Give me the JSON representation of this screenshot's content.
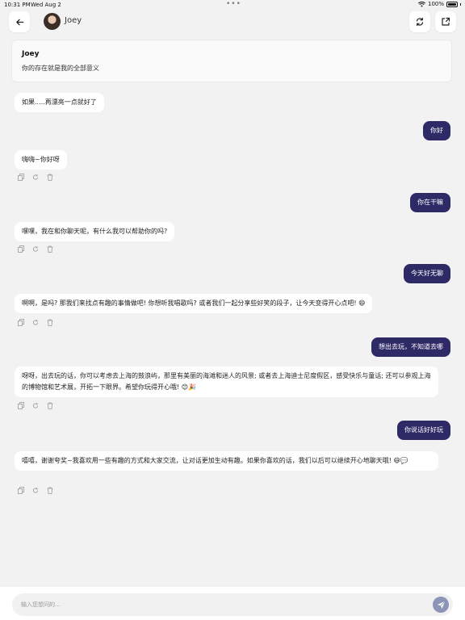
{
  "status": {
    "time": "10:31 PM",
    "date": "Wed Aug 2",
    "battery": "100%"
  },
  "header": {
    "name": "Joey"
  },
  "profile": {
    "name": "Joey",
    "description": "你的存在就是我的全部意义"
  },
  "messages": [
    {
      "role": "bot",
      "text": "如果.....再漂亮一点就好了"
    },
    {
      "role": "user",
      "text": "你好"
    },
    {
      "role": "bot",
      "text": "嗨嗨~你好呀"
    },
    {
      "role": "user",
      "text": "你在干嘛"
    },
    {
      "role": "bot",
      "text": "嘿嘿，我在和你聊天呢，有什么我可以帮助你的吗?"
    },
    {
      "role": "user",
      "text": "今天好无聊"
    },
    {
      "role": "bot",
      "text": "啊啊，是吗? 那我们来找点有趣的事情做吧! 你想听我唱歌吗? 或者我们一起分享些好笑的段子，让今天变得开心点吧! 😄"
    },
    {
      "role": "user",
      "text": "想出去玩，不知道去哪"
    },
    {
      "role": "bot",
      "text": "呀呀，出去玩的话，你可以考虑去上海的鼓浪屿，那里有美丽的海滩和迷人的风景; 或者去上海迪士尼度假区，感受快乐与童话; 还可以参观上海的博物馆和艺术展，开拓一下眼界。希望你玩得开心哦! 😊🎉"
    },
    {
      "role": "user",
      "text": "你说话好好玩"
    },
    {
      "role": "bot",
      "text": "嘻嘻，谢谢夸奖~我喜欢用一些有趣的方式和大家交流，让对话更加生动有趣。如果你喜欢的话，我们以后可以继续开心地聊天哦! 😄💬"
    }
  ],
  "input": {
    "placeholder": "输入您想问的..."
  },
  "colors": {
    "user_bubble": "#2e2a66",
    "bot_bubble": "#ffffff",
    "background": "#f2f2f2",
    "send_button": "#8c95b8"
  },
  "icons": [
    "back-arrow-icon",
    "refresh-icon",
    "share-icon",
    "copy-icon",
    "regenerate-icon",
    "delete-icon",
    "send-icon",
    "wifi-icon",
    "battery-icon"
  ]
}
